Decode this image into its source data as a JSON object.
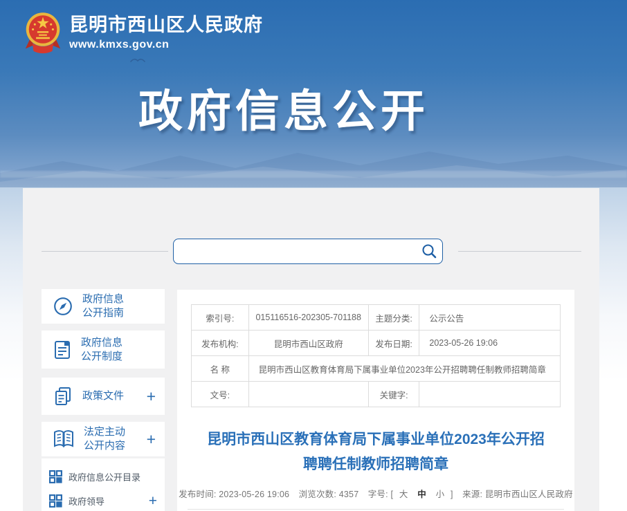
{
  "colors": {
    "brand_blue": "#2a6cb0",
    "search_border": "#1e5fa5",
    "banner_top": "#2b6db2",
    "banner_bottom": "#93b1d4",
    "panel_bg": "#f1f1f2",
    "title_blue": "#2a70b8"
  },
  "header": {
    "site_name": "昆明市西山区人民政府",
    "site_url": "www.kmxs.gov.cn",
    "banner_title": "政府信息公开"
  },
  "search": {
    "placeholder": "",
    "value": ""
  },
  "sidebar": {
    "items": [
      {
        "icon": "compass-icon",
        "line1": "政府信息",
        "line2": "公开指南",
        "plus": ""
      },
      {
        "icon": "document-icon",
        "line1": "政府信息",
        "line2": "公开制度",
        "plus": ""
      },
      {
        "icon": "documents-icon",
        "line1": "政策文件",
        "line2": "",
        "plus": "+"
      },
      {
        "icon": "open-book-icon",
        "line1": "法定主动",
        "line2": "公开内容",
        "plus": "+"
      }
    ],
    "links": [
      {
        "icon": "grid-icon",
        "label": "政府信息公开目录",
        "plus": ""
      },
      {
        "icon": "grid-icon",
        "label": "政府领导",
        "plus": "+"
      }
    ]
  },
  "info_table": {
    "row1": {
      "l1": "索引号:",
      "v1": "015116516-202305-701188",
      "l2": "主题分类:",
      "v2": "公示公告"
    },
    "row2": {
      "l1": "发布机构:",
      "v1": "昆明市西山区政府",
      "l2": "发布日期:",
      "v2": "2023-05-26 19:06"
    },
    "row3": {
      "l1": "名 称",
      "v1": "昆明市西山区教育体育局下属事业单位2023年公开招聘聘任制教师招聘简章"
    },
    "row4": {
      "l1": "文号:",
      "v1": "",
      "l2": "关键字:",
      "v2": ""
    }
  },
  "article": {
    "title": "昆明市西山区教育体育局下属事业单位2023年公开招聘聘任制教师招聘简章",
    "meta": {
      "publish_label": "发布时间:",
      "publish_time": "2023-05-26 19:06",
      "views_label": "浏览次数:",
      "views": "4357",
      "fontsize_label": "字号:",
      "bracket_open": "[",
      "size_large": "大",
      "size_medium": "中",
      "size_small": "小",
      "bracket_close": "]",
      "source_label": "来源:",
      "source": "昆明市西山区人民政府"
    }
  }
}
